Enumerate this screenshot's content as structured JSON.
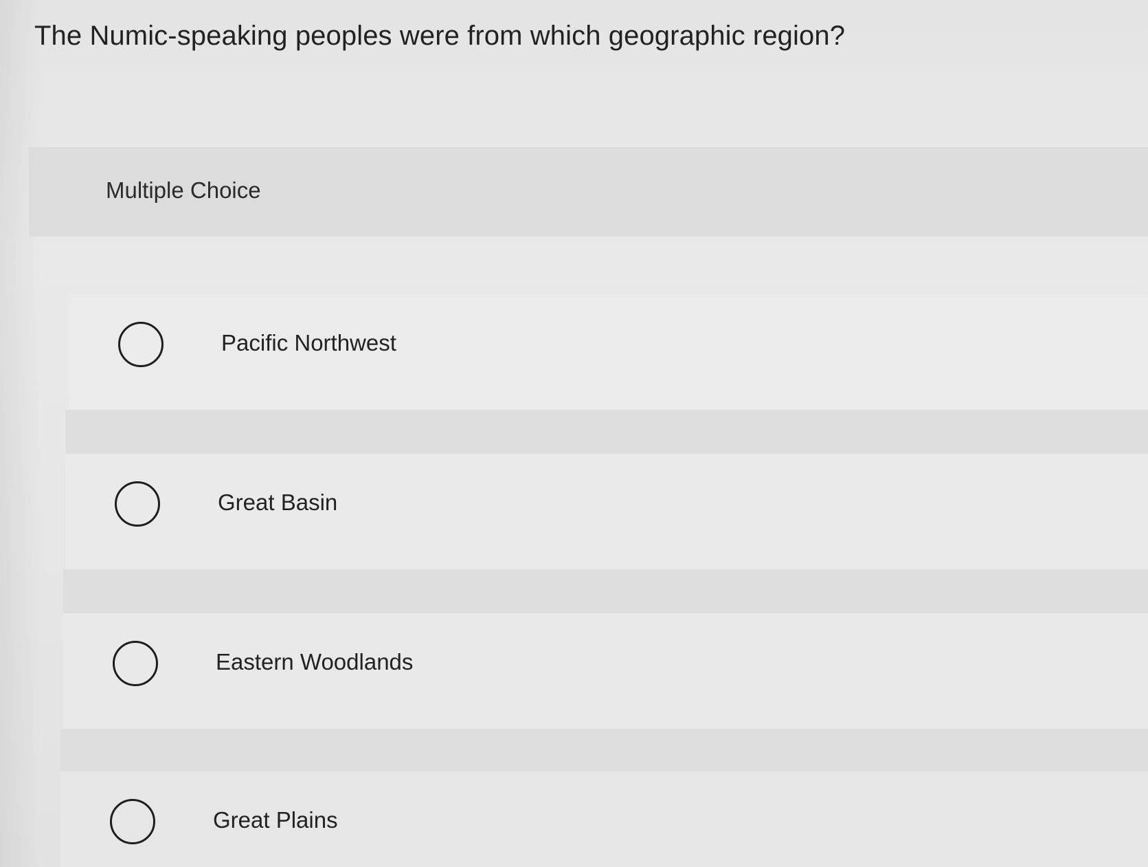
{
  "question": {
    "text": "The Numic-speaking peoples were from which geographic region?"
  },
  "question_type": {
    "label": "Multiple Choice"
  },
  "options": [
    {
      "label": "Pacific Northwest",
      "selected": false
    },
    {
      "label": "Great Basin",
      "selected": false
    },
    {
      "label": "Eastern Woodlands",
      "selected": false
    },
    {
      "label": "Great Plains",
      "selected": false
    }
  ]
}
